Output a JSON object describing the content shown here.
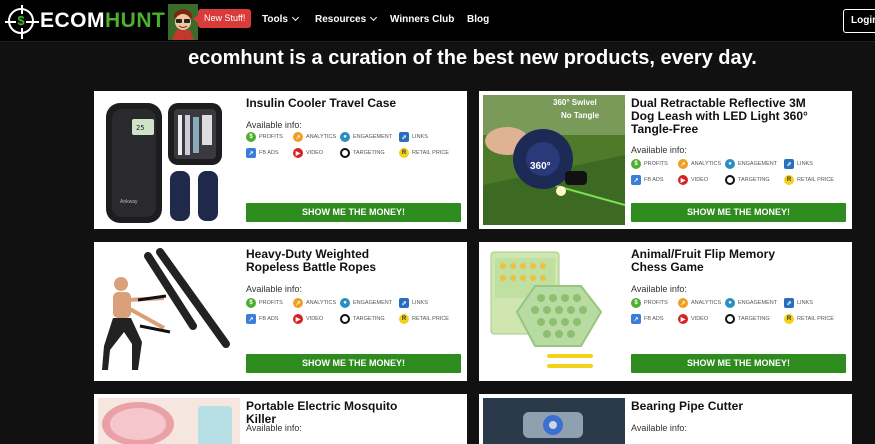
{
  "nav": {
    "logo_text": "ECOM",
    "logo_text_green": "HUNT",
    "logo_symbol": "$",
    "new_badge": "New Stuff!",
    "items": [
      "Tools",
      "Resources",
      "Winners Club",
      "Blog"
    ],
    "login": "Login"
  },
  "headline": "ecomhunt is a curation of the best new products, every day.",
  "products": [
    {
      "title": "Insulin Cooler Travel Case",
      "available": "Available info:",
      "button": "SHOW ME THE MONEY!"
    },
    {
      "title": "Dual Retractable Reflective 3M Dog Leash with LED Light 360° Tangle-Free",
      "available": "Available info:",
      "button": "SHOW ME THE MONEY!",
      "image_overlay": [
        "360° Swivel",
        "No Tangle"
      ]
    },
    {
      "title": "Heavy-Duty Weighted Ropeless Battle Ropes",
      "available": "Available info:",
      "button": "SHOW ME THE MONEY!"
    },
    {
      "title": "Animal/Fruit Flip Memory Chess Game",
      "available": "Available info:",
      "button": "SHOW ME THE MONEY!"
    },
    {
      "title": "Portable Electric Mosquito Killer",
      "available": "Available info:"
    },
    {
      "title": "Bearing Pipe Cutter",
      "available": "Available info:"
    }
  ],
  "info_tags": [
    "PROFITS",
    "ANALYTICS",
    "ENGAGEMENT",
    "LINKS",
    "FB ADS",
    "VIDEO",
    "TARGETING",
    "RETAIL PRICE"
  ],
  "colors": {
    "accent_green": "#2e8b1e",
    "profits": "#4caf2e",
    "analytics": "#f0a020",
    "engagement": "#2a8fbf",
    "links": "#2a6fbf",
    "fbads": "#3b7dd8",
    "video": "#d92020",
    "targeting": "#111111",
    "retail": "#f2d21b",
    "badge": "#d93a3a"
  }
}
